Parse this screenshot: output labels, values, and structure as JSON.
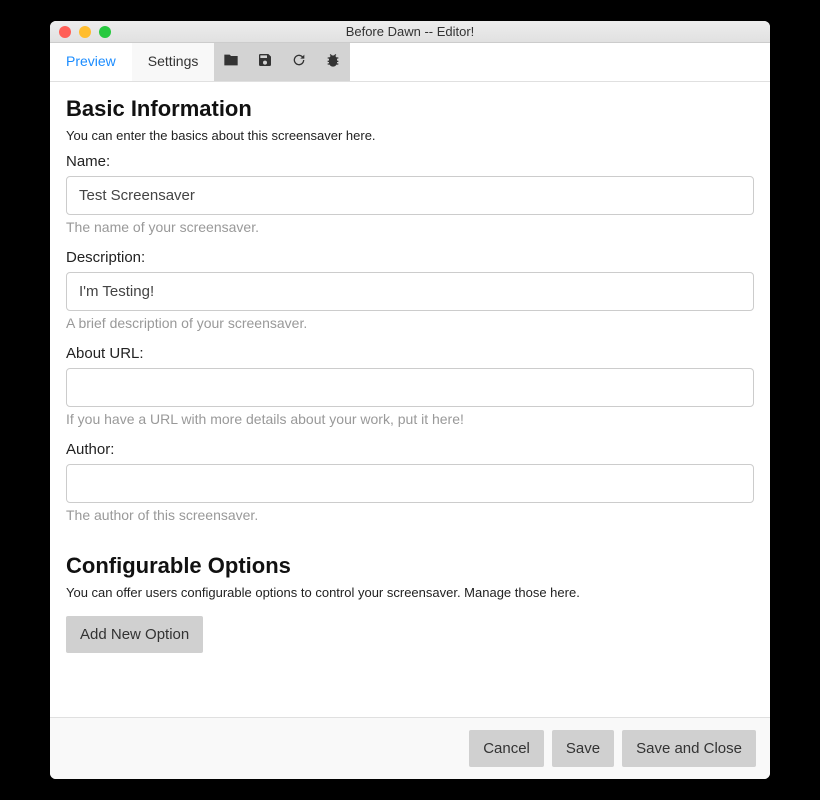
{
  "window": {
    "title": "Before Dawn -- Editor!"
  },
  "tabs": {
    "preview": "Preview",
    "settings": "Settings"
  },
  "toolbar": {
    "folder": "folder-icon",
    "save": "save-icon",
    "refresh": "refresh-icon",
    "debug": "bug-icon"
  },
  "basic": {
    "heading": "Basic Information",
    "desc": "You can enter the basics about this screensaver here.",
    "name_label": "Name:",
    "name_value": "Test Screensaver",
    "name_hint": "The name of your screensaver.",
    "desc_label": "Description:",
    "desc_value": "I'm Testing!",
    "desc_hint": "A brief description of your screensaver.",
    "about_label": "About URL:",
    "about_value": "",
    "about_hint": "If you have a URL with more details about your work, put it here!",
    "author_label": "Author:",
    "author_value": "",
    "author_hint": "The author of this screensaver."
  },
  "options": {
    "heading": "Configurable Options",
    "desc": "You can offer users configurable options to control your screensaver. Manage those here.",
    "add_button": "Add New Option"
  },
  "footer": {
    "cancel": "Cancel",
    "save": "Save",
    "save_close": "Save and Close"
  }
}
